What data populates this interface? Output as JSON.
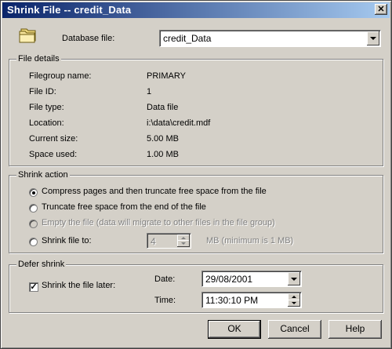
{
  "window": {
    "title": "Shrink File -- credit_Data",
    "close_label": "✕"
  },
  "database_file": {
    "label": "Database file:",
    "value": "credit_Data"
  },
  "file_details": {
    "title": "File details",
    "rows": [
      {
        "label": "Filegroup name:",
        "value": "PRIMARY"
      },
      {
        "label": "File ID:",
        "value": "1"
      },
      {
        "label": "File type:",
        "value": "Data file"
      },
      {
        "label": "Location:",
        "value": "i:\\data\\credit.mdf"
      },
      {
        "label": "Current size:",
        "value": "5.00 MB"
      },
      {
        "label": "Space used:",
        "value": "1.00 MB"
      }
    ]
  },
  "shrink_action": {
    "title": "Shrink action",
    "options": [
      {
        "label": "Compress pages and then truncate free space from the file",
        "selected": true,
        "enabled": true
      },
      {
        "label": "Truncate free space from the end of the file",
        "selected": false,
        "enabled": true
      },
      {
        "label": "Empty the file (data will migrate to other files in the file group)",
        "selected": false,
        "enabled": false
      },
      {
        "label": "Shrink file to:",
        "selected": false,
        "enabled": true
      }
    ],
    "shrink_to_value": "4",
    "shrink_to_unit": "MB (minimum is 1 MB)"
  },
  "defer_shrink": {
    "title": "Defer shrink",
    "checkbox_label": "Shrink the file later:",
    "checked": true,
    "date_label": "Date:",
    "date_value": "29/08/2001",
    "time_label": "Time:",
    "time_value": "11:30:10 PM"
  },
  "buttons": {
    "ok": "OK",
    "cancel": "Cancel",
    "help": "Help"
  },
  "icons": {
    "folder": "folder-icon",
    "close": "close-icon",
    "dropdown": "chevron-down-icon",
    "check": "check-icon"
  },
  "colors": {
    "face": "#d4d0c8",
    "title_start": "#0a246a",
    "title_end": "#a6caf0",
    "disabled_text": "#808080"
  }
}
